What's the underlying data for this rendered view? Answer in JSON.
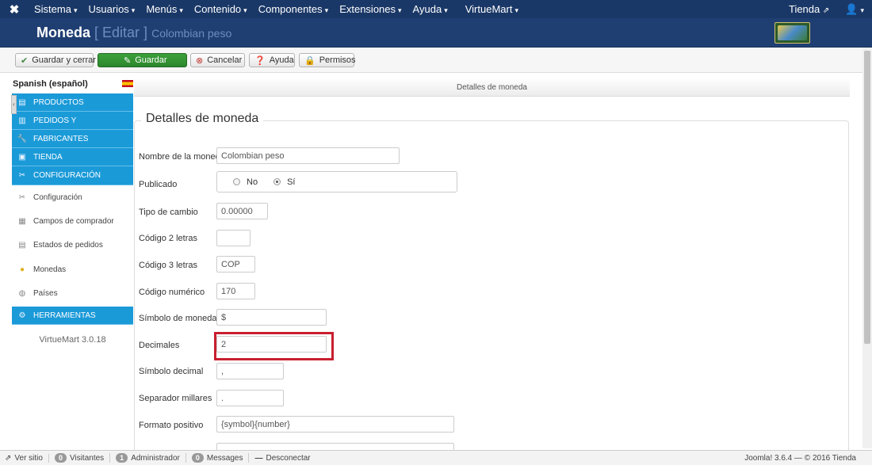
{
  "navbar": {
    "logo_icon": "joomla-icon",
    "menus": [
      {
        "label": "Sistema"
      },
      {
        "label": "Usuarios"
      },
      {
        "label": "Menús"
      },
      {
        "label": "Contenido"
      },
      {
        "label": "Componentes"
      },
      {
        "label": "Extensiones"
      },
      {
        "label": "Ayuda"
      },
      {
        "label": "VirtueMart"
      }
    ],
    "site_link": "Tienda",
    "user_icon": "user-icon"
  },
  "header": {
    "title_main": "Moneda",
    "title_action": "[ Editar ]",
    "title_item": "Colombian peso"
  },
  "toolbar": {
    "save_close": "Guardar y cerrar",
    "save": "Guardar",
    "cancel": "Cancelar",
    "help": "Ayuda",
    "permissions": "Permisos"
  },
  "sidebar": {
    "language": "Spanish (español)",
    "items": [
      {
        "label": "PRODUCTOS",
        "icon": "products-icon"
      },
      {
        "label": "PEDIDOS Y",
        "icon": "orders-icon"
      },
      {
        "label": "FABRICANTES",
        "icon": "wrench-icon"
      },
      {
        "label": "TIENDA",
        "icon": "store-icon"
      },
      {
        "label": "CONFIGURACIÓN",
        "icon": "config-icon"
      }
    ],
    "sub_items": [
      {
        "label": "Configuración",
        "icon": "tools-icon"
      },
      {
        "label": "Campos de comprador",
        "icon": "shopper-fields-icon"
      },
      {
        "label": "Estados de pedidos",
        "icon": "order-status-icon"
      },
      {
        "label": "Monedas",
        "icon": "coins-icon"
      },
      {
        "label": "Países",
        "icon": "globe-icon"
      }
    ],
    "tools": {
      "label": "HERRAMIENTAS",
      "icon": "tools-box-icon"
    },
    "version": "VirtueMart 3.0.18"
  },
  "main": {
    "panel_title": "Detalles de moneda",
    "legend": "Detalles de moneda",
    "fields": {
      "name_label": "Nombre de la moneda",
      "name_value": "Colombian peso",
      "published_label": "Publicado",
      "published_no": "No",
      "published_yes": "Sí",
      "published_value": "Sí",
      "rate_label": "Tipo de cambio",
      "rate_value": "0.00000",
      "code2_label": "Código 2 letras",
      "code2_value": "",
      "code3_label": "Código 3 letras",
      "code3_value": "COP",
      "numeric_label": "Código numérico",
      "numeric_value": "170",
      "symbol_label": "Símbolo de moneda",
      "symbol_value": "$",
      "decimals_label": "Decimales",
      "decimals_value": "2",
      "decimal_symbol_label": "Símbolo decimal",
      "decimal_symbol_value": ",",
      "thousands_label": "Separador millares",
      "thousands_value": ".",
      "positive_format_label": "Formato positivo",
      "positive_format_value": "{symbol}{number}"
    }
  },
  "statusbar": {
    "view_site": "Ver sitio",
    "visitors_count": "0",
    "visitors_label": "Visitantes",
    "admins_count": "1",
    "admins_label": "Administrador",
    "messages_count": "0",
    "messages_label": "Messages",
    "logout": "Desconectar",
    "version_info": "Joomla! 3.6.4 — © 2016 Tienda"
  },
  "colors": {
    "navbar": "#1a3867",
    "header": "#1f3f73",
    "sidebar_active": "#1b9ad8",
    "save_button": "#2d862d",
    "highlight": "#c8202f"
  }
}
